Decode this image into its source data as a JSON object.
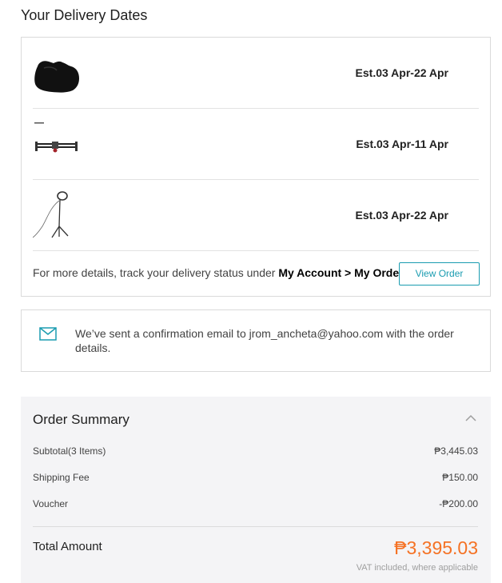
{
  "page": {
    "title": "Your Delivery Dates"
  },
  "delivery": {
    "items": [
      {
        "icon": "camera-cover-icon",
        "date": "Est.03 Apr-22 Apr"
      },
      {
        "icon": "camera-slider-icon",
        "date": "Est.03 Apr-11 Apr"
      },
      {
        "icon": "ring-light-tripod-icon",
        "date": "Est.03 Apr-22 Apr"
      }
    ],
    "track_text": "For more details, track your delivery status under ",
    "track_link": "My Account > My Order",
    "view_order_label": "View Order"
  },
  "confirmation": {
    "icon": "mail-icon",
    "text": "We’ve sent a confirmation email to jrom_ancheta@yahoo.com with the order details."
  },
  "summary": {
    "title": "Order Summary",
    "rows": [
      {
        "label": "Subtotal(3 Items)",
        "value": "₱3,445.03"
      },
      {
        "label": "Shipping Fee",
        "value": "₱150.00"
      },
      {
        "label": "Voucher",
        "value": "-₱200.00"
      }
    ],
    "total_label": "Total Amount",
    "total_value": "₱3,395.03",
    "vat_note": "VAT included, where applicable",
    "accent_color": "#f57224",
    "link_color": "#1a9cb0"
  }
}
